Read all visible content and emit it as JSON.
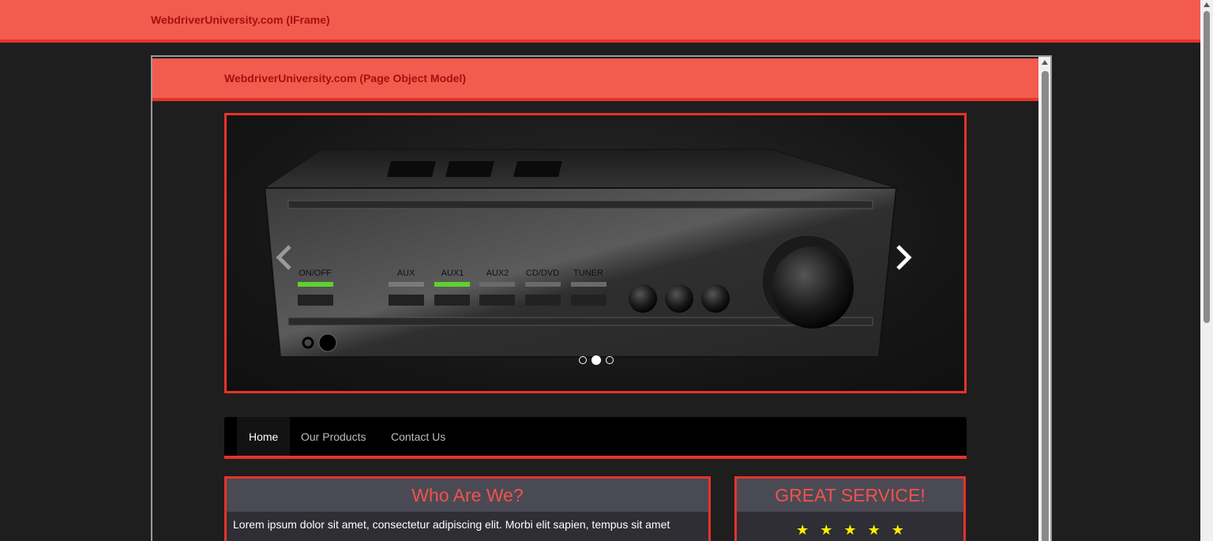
{
  "outer_header": {
    "title": "WebdriverUniversity.com (IFrame)"
  },
  "iframe": {
    "header": {
      "title": "WebdriverUniversity.com (Page Object Model)"
    },
    "carousel": {
      "amplifier_labels": [
        "ON/OFF",
        "AUX",
        "AUX1",
        "AUX2",
        "CD/DVD",
        "TUNER"
      ],
      "active_slide": 2,
      "slide_count": 3,
      "accent_color": "#e5332a"
    },
    "nav": {
      "items": [
        {
          "label": "Home",
          "active": true
        },
        {
          "label": "Our Products",
          "active": false
        },
        {
          "label": "Contact Us",
          "active": false
        }
      ]
    },
    "panels": {
      "who": {
        "title": "Who Are We?",
        "text": "Lorem ipsum dolor sit amet, consectetur adipiscing elit. Morbi elit sapien, tempus sit amet"
      },
      "great": {
        "title": "GREAT SERVICE!",
        "rating": 5
      }
    }
  },
  "colors": {
    "header_bg": "#f35b4f",
    "header_border": "#e5332a",
    "title_text": "#a3120c",
    "star": "#ffee00"
  }
}
